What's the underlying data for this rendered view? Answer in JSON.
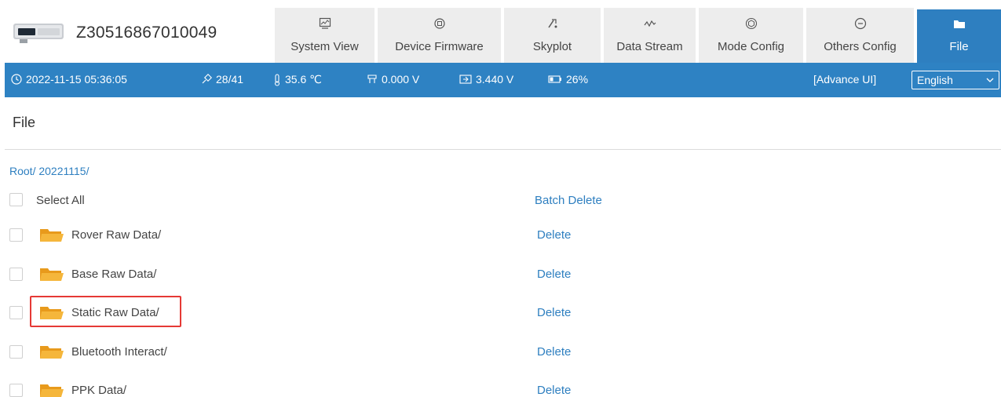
{
  "header": {
    "device_id": "Z30516867010049",
    "tabs": [
      {
        "label": "System View",
        "icon": "monitor-icon",
        "active": false
      },
      {
        "label": "Device Firmware",
        "icon": "chip-icon",
        "active": false
      },
      {
        "label": "Skyplot",
        "icon": "satellite-icon",
        "active": false
      },
      {
        "label": "Data Stream",
        "icon": "waveform-icon",
        "active": false
      },
      {
        "label": "Mode Config",
        "icon": "cube-icon",
        "active": false
      },
      {
        "label": "Others Config",
        "icon": "minus-circle-icon",
        "active": false
      },
      {
        "label": "File",
        "icon": "folder-icon",
        "active": true
      }
    ]
  },
  "status": {
    "datetime": "2022-11-15 05:36:05",
    "satellites": "28/41",
    "temperature": "35.6 ℃",
    "voltage_ext": "0.000 V",
    "voltage_bat": "3.440 V",
    "battery": "26%",
    "advance_ui": "[Advance UI]",
    "language": "English"
  },
  "page": {
    "title": "File",
    "breadcrumb": "Root/ 20221115/",
    "select_all": "Select All",
    "batch_delete": "Batch Delete",
    "delete_label": "Delete",
    "items": [
      {
        "name": "Rover Raw Data/"
      },
      {
        "name": "Base Raw Data/"
      },
      {
        "name": "Static Raw Data/"
      },
      {
        "name": "Bluetooth Interact/"
      },
      {
        "name": "PPK Data/"
      }
    ]
  },
  "colors": {
    "accent": "#2e82c3",
    "folder": "#f5a623",
    "highlight": "#e53935"
  }
}
